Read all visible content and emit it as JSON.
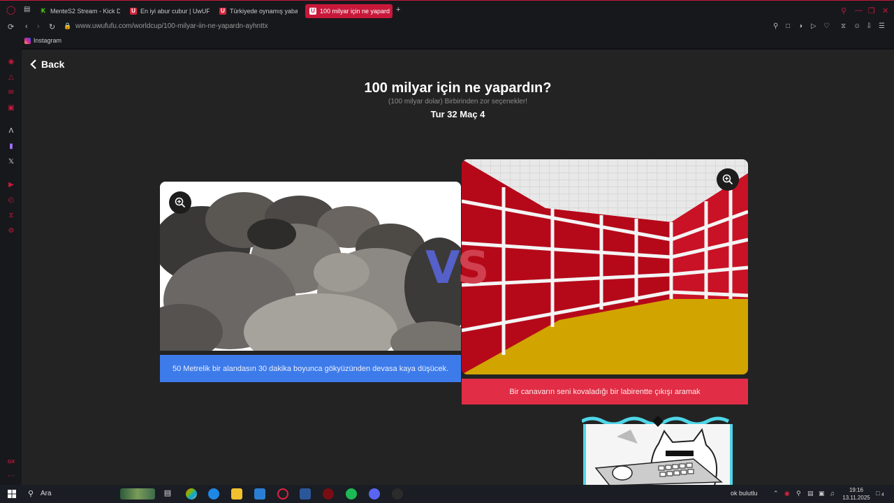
{
  "browser": {
    "tabs": [
      {
        "label": "MenteS2 Stream - Kick D",
        "favicon": "kick-icon",
        "color": "#53fc18"
      },
      {
        "label": "En iyi abur cubur | UwUF",
        "favicon": "uwufufu-icon",
        "color": "#d6263c"
      },
      {
        "label": "Türkiyede oynamış yaban",
        "favicon": "uwufufu-icon",
        "color": "#d6263c"
      },
      {
        "label": "100 milyar için ne yapard",
        "favicon": "uwufufu-icon",
        "color": "#ffffff",
        "active": true
      }
    ],
    "new_tab": "+",
    "url": "www.uwufufu.com/worldcup/100-milyar-iin-ne-yapardn-ayhnttx",
    "bookmark": "Instagram",
    "accent": "#c8183a"
  },
  "page": {
    "back_label": "Back",
    "title": "100 milyar için ne yapardın?",
    "subtitle": "(100 milyar dolar) Birbirinden zor seçenekler!",
    "round": "Tur 32 Maç 4",
    "vs_v": "V",
    "vs_s": "S",
    "left_option": {
      "caption": "50 Metrelik bir alandasın 30 dakika boyunca gökyüzünden devasa kaya düşücek.",
      "image": "rocks-pile",
      "color": "#3d7bea"
    },
    "right_option": {
      "caption": "Bir canavarın seni kovaladığı bir labirentte çıkışı aramak",
      "image": "red-brick-maze",
      "color": "#e12d45"
    }
  },
  "taskbar": {
    "search": "Ara",
    "weather": "ok bulutlu",
    "time": "19:16",
    "date": "13.11.2025",
    "notification_count": "4"
  }
}
